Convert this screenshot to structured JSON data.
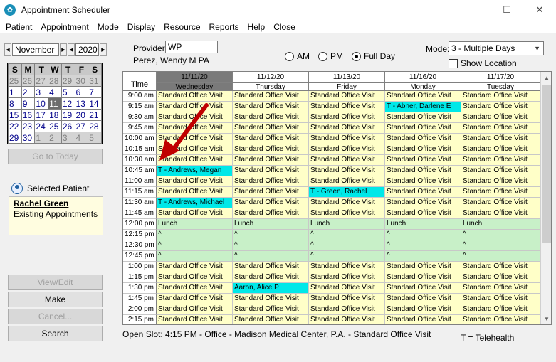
{
  "window": {
    "title": "Appointment Scheduler",
    "icon": "app-logo-icon"
  },
  "menu": [
    "Patient",
    "Appointment",
    "Mode",
    "Display",
    "Resource",
    "Reports",
    "Help",
    "Close"
  ],
  "calendar_nav": {
    "month": "November",
    "year": "2020"
  },
  "calendar": {
    "day_headers": [
      "S",
      "M",
      "T",
      "W",
      "T",
      "F",
      "S"
    ],
    "weeks": [
      [
        {
          "d": "25",
          "o": true
        },
        {
          "d": "26",
          "o": true
        },
        {
          "d": "27",
          "o": true
        },
        {
          "d": "28",
          "o": true
        },
        {
          "d": "29",
          "o": true
        },
        {
          "d": "30",
          "o": true
        },
        {
          "d": "31",
          "o": true
        }
      ],
      [
        {
          "d": "1"
        },
        {
          "d": "2"
        },
        {
          "d": "3"
        },
        {
          "d": "4"
        },
        {
          "d": "5"
        },
        {
          "d": "6"
        },
        {
          "d": "7"
        }
      ],
      [
        {
          "d": "8"
        },
        {
          "d": "9"
        },
        {
          "d": "10"
        },
        {
          "d": "11",
          "c": true
        },
        {
          "d": "12"
        },
        {
          "d": "13"
        },
        {
          "d": "14"
        }
      ],
      [
        {
          "d": "15"
        },
        {
          "d": "16"
        },
        {
          "d": "17"
        },
        {
          "d": "18"
        },
        {
          "d": "19"
        },
        {
          "d": "20"
        },
        {
          "d": "21"
        }
      ],
      [
        {
          "d": "22"
        },
        {
          "d": "23"
        },
        {
          "d": "24"
        },
        {
          "d": "25"
        },
        {
          "d": "26"
        },
        {
          "d": "27"
        },
        {
          "d": "28"
        }
      ],
      [
        {
          "d": "29"
        },
        {
          "d": "30"
        },
        {
          "d": "1",
          "o": true
        },
        {
          "d": "2",
          "o": true
        },
        {
          "d": "3",
          "o": true
        },
        {
          "d": "4",
          "o": true
        },
        {
          "d": "5",
          "o": true
        }
      ]
    ]
  },
  "buttons": {
    "go_today": "Go to Today",
    "view_edit": "View/Edit",
    "make": "Make",
    "cancel": "Cancel...",
    "search": "Search"
  },
  "selected_patient": {
    "label": "Selected Patient",
    "name": "Rachel Green",
    "link": "Existing Appointments"
  },
  "provider": {
    "label": "Provider:",
    "code": "WP",
    "name": "Perez, Wendy M PA"
  },
  "time_filter": {
    "options": [
      "AM",
      "PM",
      "Full Day"
    ],
    "selected": "Full Day"
  },
  "mode": {
    "label": "Mode:",
    "value": "3 - Multiple Days",
    "show_location": "Show Location"
  },
  "schedule": {
    "time_header": "Time",
    "days": [
      {
        "date": "11/11/20",
        "day": "Wednesday"
      },
      {
        "date": "11/12/20",
        "day": "Thursday"
      },
      {
        "date": "11/13/20",
        "day": "Friday"
      },
      {
        "date": "11/16/20",
        "day": "Monday"
      },
      {
        "date": "11/17/20",
        "day": "Tuesday"
      }
    ],
    "rows": [
      {
        "time": "9:00 am",
        "kind": "slot",
        "cells": [
          "Standard Office Visit",
          "Standard Office Visit",
          "Standard Office Visit",
          "Standard Office Visit",
          "Standard Office Visit"
        ]
      },
      {
        "time": "9:15 am",
        "kind": "slot",
        "cells": [
          "Standard Office Visit",
          "Standard Office Visit",
          "Standard Office Visit",
          "T - Abner, Darlene E",
          "Standard Office Visit"
        ],
        "booked": [
          3
        ]
      },
      {
        "time": "9:30 am",
        "kind": "slot",
        "cells": [
          "Standard Office Visit",
          "Standard Office Visit",
          "Standard Office Visit",
          "Standard Office Visit",
          "Standard Office Visit"
        ]
      },
      {
        "time": "9:45 am",
        "kind": "slot",
        "cells": [
          "Standard Office Visit",
          "Standard Office Visit",
          "Standard Office Visit",
          "Standard Office Visit",
          "Standard Office Visit"
        ]
      },
      {
        "time": "10:00 am",
        "kind": "slot",
        "cells": [
          "Standard Office Visit",
          "Standard Office Visit",
          "Standard Office Visit",
          "Standard Office Visit",
          "Standard Office Visit"
        ]
      },
      {
        "time": "10:15 am",
        "kind": "slot",
        "cells": [
          "Standard Office Visit",
          "Standard Office Visit",
          "Standard Office Visit",
          "Standard Office Visit",
          "Standard Office Visit"
        ]
      },
      {
        "time": "10:30 am",
        "kind": "slot",
        "cells": [
          "Standard Office Visit",
          "Standard Office Visit",
          "Standard Office Visit",
          "Standard Office Visit",
          "Standard Office Visit"
        ]
      },
      {
        "time": "10:45 am",
        "kind": "slot",
        "cells": [
          "T - Andrews, Megan",
          "Standard Office Visit",
          "Standard Office Visit",
          "Standard Office Visit",
          "Standard Office Visit"
        ],
        "booked": [
          0
        ]
      },
      {
        "time": "11:00 am",
        "kind": "slot",
        "cells": [
          "Standard Office Visit",
          "Standard Office Visit",
          "Standard Office Visit",
          "Standard Office Visit",
          "Standard Office Visit"
        ]
      },
      {
        "time": "11:15 am",
        "kind": "slot",
        "cells": [
          "Standard Office Visit",
          "Standard Office Visit",
          "T - Green, Rachel",
          "Standard Office Visit",
          "Standard Office Visit"
        ],
        "booked": [
          2
        ]
      },
      {
        "time": "11:30 am",
        "kind": "slot",
        "cells": [
          "T - Andrews, Michael",
          "Standard Office Visit",
          "Standard Office Visit",
          "Standard Office Visit",
          "Standard Office Visit"
        ],
        "booked": [
          0
        ]
      },
      {
        "time": "11:45 am",
        "kind": "slot",
        "cells": [
          "Standard Office Visit",
          "Standard Office Visit",
          "Standard Office Visit",
          "Standard Office Visit",
          "Standard Office Visit"
        ]
      },
      {
        "time": "12:00 pm",
        "kind": "lunch",
        "cells": [
          "Lunch",
          "Lunch",
          "Lunch",
          "Lunch",
          "Lunch"
        ]
      },
      {
        "time": "12:15 pm",
        "kind": "lunch",
        "cells": [
          "^",
          "^",
          "^",
          "^",
          "^"
        ]
      },
      {
        "time": "12:30 pm",
        "kind": "lunch",
        "cells": [
          "^",
          "^",
          "^",
          "^",
          "^"
        ]
      },
      {
        "time": "12:45 pm",
        "kind": "lunch",
        "cells": [
          "^",
          "^",
          "^",
          "^",
          "^"
        ]
      },
      {
        "time": "1:00 pm",
        "kind": "slot",
        "cells": [
          "Standard Office Visit",
          "Standard Office Visit",
          "Standard Office Visit",
          "Standard Office Visit",
          "Standard Office Visit"
        ]
      },
      {
        "time": "1:15 pm",
        "kind": "slot",
        "cells": [
          "Standard Office Visit",
          "Standard Office Visit",
          "Standard Office Visit",
          "Standard Office Visit",
          "Standard Office Visit"
        ]
      },
      {
        "time": "1:30 pm",
        "kind": "slot",
        "cells": [
          "Standard Office Visit",
          "Aaron, Alice P",
          "Standard Office Visit",
          "Standard Office Visit",
          "Standard Office Visit"
        ],
        "booked": [
          1
        ]
      },
      {
        "time": "1:45 pm",
        "kind": "slot",
        "cells": [
          "Standard Office Visit",
          "Standard Office Visit",
          "Standard Office Visit",
          "Standard Office Visit",
          "Standard Office Visit"
        ]
      },
      {
        "time": "2:00 pm",
        "kind": "slot",
        "cells": [
          "Standard Office Visit",
          "Standard Office Visit",
          "Standard Office Visit",
          "Standard Office Visit",
          "Standard Office Visit"
        ]
      },
      {
        "time": "2:15 pm",
        "kind": "slot",
        "cells": [
          "Standard Office Visit",
          "Standard Office Visit",
          "Standard Office Visit",
          "Standard Office Visit",
          "Standard Office Visit"
        ]
      }
    ]
  },
  "status": {
    "open_slot": "Open Slot: 4:15 PM - Office - Madison Medical Center, P.A. - Standard Office Visit",
    "legend": "T = Telehealth"
  },
  "colors": {
    "slot": "#ffffc8",
    "lunch": "#c8f0c8",
    "booked": "#00e8e8",
    "annotation_arrow": "#c00000"
  }
}
